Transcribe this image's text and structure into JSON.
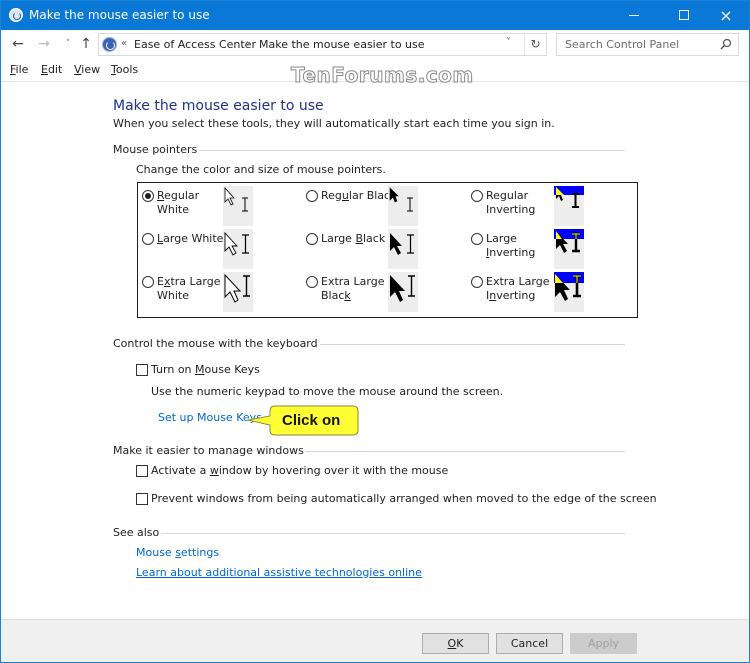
{
  "window": {
    "title": "Make the mouse easier to use",
    "minimize_label": "Minimize",
    "maximize_label": "Maximize",
    "close_label": "×"
  },
  "navigation": {
    "back_icon": "←",
    "forward_icon": "→",
    "recent_icon": "˅",
    "up_icon": "↑",
    "breadcrumb_prefix": "«",
    "breadcrumbs": [
      "Ease of Access Center",
      "Make the mouse easier to use"
    ],
    "breadcrumb_separator": "›",
    "dropdown_icon": "˅",
    "refresh_icon": "↻",
    "search_placeholder": "Search Control Panel"
  },
  "menu": {
    "items": [
      {
        "accel": "F",
        "rest": "ile"
      },
      {
        "accel": "E",
        "rest": "dit"
      },
      {
        "accel": "V",
        "rest": "iew"
      },
      {
        "accel": "T",
        "rest": "ools"
      }
    ]
  },
  "watermark": "TenForums.com",
  "page": {
    "title": "Make the mouse easier to use",
    "subtitle": "When you select these tools, they will automatically start each time you sign in."
  },
  "mouse_pointers": {
    "header": "Mouse pointers",
    "description": "Change the color and size of mouse pointers.",
    "selected": "regular-white",
    "options": [
      {
        "id": "regular-white",
        "line1": "Regular",
        "line2": "White",
        "checked": true
      },
      {
        "id": "regular-black",
        "line1": "Regular Black",
        "line2": "",
        "checked": false
      },
      {
        "id": "regular-inverting",
        "line1": "Regular",
        "line2": "Inverting",
        "checked": false
      },
      {
        "id": "large-white",
        "line1": "Large White",
        "line2": "",
        "checked": false
      },
      {
        "id": "large-black",
        "line1": "Large Black",
        "line2": "",
        "checked": false
      },
      {
        "id": "large-inverting",
        "line1": "Large",
        "line2": "Inverting",
        "checked": false
      },
      {
        "id": "extra-large-white",
        "line1": "Extra Large",
        "line2": "White",
        "checked": false
      },
      {
        "id": "extra-large-black",
        "line1": "Extra Large",
        "line2": "Black",
        "checked": false
      },
      {
        "id": "extra-large-inverting",
        "line1": "Extra Large",
        "line2": "Inverting",
        "checked": false
      }
    ]
  },
  "keyboard_control": {
    "header": "Control the mouse with the keyboard",
    "mouse_keys_label": "Turn on Mouse Keys",
    "mouse_keys_checked": false,
    "description": "Use the numeric keypad to move the mouse around the screen.",
    "setup_link": "Set up Mouse Keys"
  },
  "callout": {
    "text": "Click on",
    "color": "#ffff33"
  },
  "manage_windows": {
    "header": "Make it easier to manage windows",
    "options": [
      {
        "label": "Activate a window by hovering over it with the mouse",
        "checked": false
      },
      {
        "label": "Prevent windows from being automatically arranged when moved to the edge of the screen",
        "checked": false
      }
    ]
  },
  "see_also": {
    "header": "See also",
    "links": [
      "Mouse settings",
      "Learn about additional assistive technologies online"
    ]
  },
  "footer": {
    "ok_accel": "O",
    "ok_rest": "K",
    "cancel_label": "Cancel",
    "apply_label": "Apply",
    "apply_enabled": false
  },
  "colors": {
    "titlebar": "#0a78d7",
    "title_text": "#1e3287",
    "link": "#0066cc",
    "inverting_blue": "#0000ff",
    "inverting_yellow": "#ffff00"
  }
}
